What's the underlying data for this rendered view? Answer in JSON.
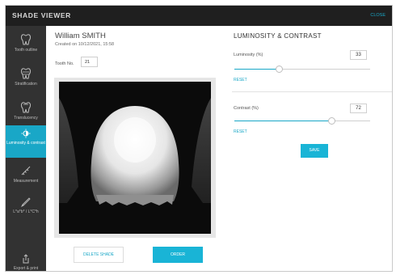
{
  "app": {
    "title": "SHADE VIEWER",
    "close_label": "CLOSE"
  },
  "sidebar": {
    "items": [
      {
        "label": "Tooth outline",
        "icon": "tooth-icon"
      },
      {
        "label": "Stratification",
        "icon": "layers-tooth-icon"
      },
      {
        "label": "Translucency",
        "icon": "translucency-tooth-icon"
      },
      {
        "label": "Luminosity & contrast",
        "icon": "half-sun-icon",
        "active": true
      },
      {
        "label": "Measurement",
        "icon": "ruler-icon"
      },
      {
        "label": "L*a*b* / L*C*h",
        "icon": "pen-icon"
      },
      {
        "label": "Export & print",
        "icon": "export-icon"
      }
    ]
  },
  "patient": {
    "name": "William SMITH",
    "created": "Created on 10/12/2021, 15:58",
    "tooth_label": "Tooth No.",
    "tooth_number": "21"
  },
  "actions": {
    "delete_label": "DELETE SHADE",
    "order_label": "ORDER"
  },
  "panel": {
    "title": "LUMINOSITY & CONTRAST",
    "luminosity": {
      "label": "Luminosity (%)",
      "value": "33",
      "level": 0.33,
      "reset": "RESET"
    },
    "contrast": {
      "label": "Contrast (%)",
      "value": "72",
      "level": 0.72,
      "reset": "RESET"
    },
    "save_label": "SAVE"
  },
  "colors": {
    "accent": "#19a7c7",
    "topbar": "#1f1f1f",
    "sidebar": "#323232"
  }
}
